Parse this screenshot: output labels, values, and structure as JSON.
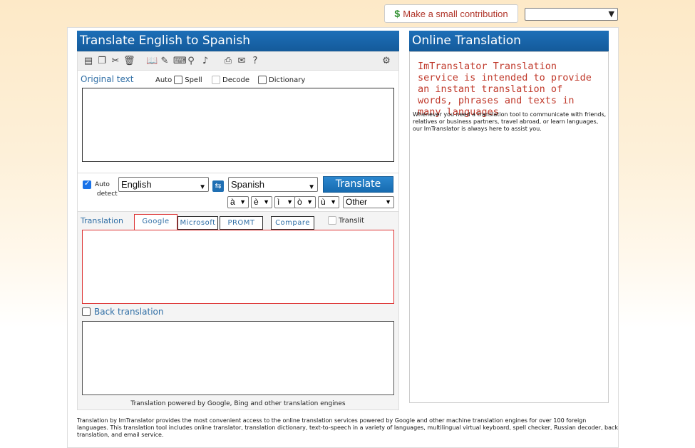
{
  "top": {
    "contribution_label": "Make a small contribution",
    "contribution_symbol": "$",
    "dropdown_value": ""
  },
  "left": {
    "title": "Translate English to Spanish",
    "original_label": "Original text",
    "options": [
      "Auto",
      "Spell",
      "Decode",
      "Dictionary"
    ],
    "auto_detect_line1": "Auto",
    "auto_detect_line2": "detect",
    "source_language": "English",
    "target_language": "Spanish",
    "translate_button": "Translate",
    "accents": [
      "à",
      "è",
      "ì",
      "ò",
      "ù"
    ],
    "other_label": "Other",
    "translation_label": "Translation",
    "tabs": [
      "Google",
      "Microsoft",
      "PROMT",
      "Compare"
    ],
    "translit_label": "Translit",
    "back_translation_label": "Back translation",
    "powered_by": "Translation powered by Google, Bing and other translation engines",
    "original_text": "",
    "translation_text": "",
    "back_translation_text": ""
  },
  "right": {
    "title": "Online Translation",
    "headline": "ImTranslator Translation service is intended to provide an instant translation of words, phrases and texts in many languages",
    "body": "Whenever you need a translation tool to communicate with friends, relatives or business partners, travel abroad, or learn languages, our ImTranslator is always here to assist you."
  },
  "footer": {
    "text": "Translation by ImTranslator provides the most convenient access to the online translation services powered by Google and other machine translation engines for over 100 foreign languages. This translation tool includes online translator, translation dictionary, text-to-speech in a variety of languages, multilingual virtual keyboard, spell checker, Russian decoder, back translation, and email service."
  },
  "colors": {
    "accent_blue": "#1d6fb8",
    "label_blue": "#2f6ea5",
    "headline_red": "#c0392b",
    "translation_border_red": "#dd3333"
  }
}
